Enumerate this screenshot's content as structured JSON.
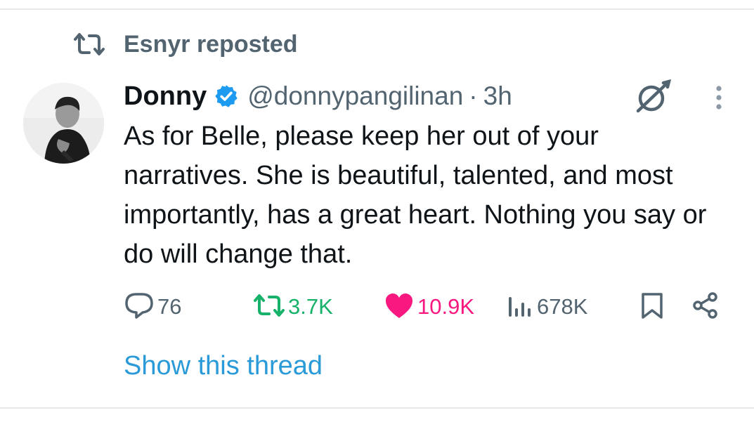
{
  "repost": {
    "label": "Esnyr reposted"
  },
  "tweet": {
    "display_name": "Donny",
    "handle": "@donnypangilinan",
    "separator": "·",
    "time": "3h",
    "text": "As for Belle, please keep her out of your narratives. She is beautiful, talented, and most importantly, has a great heart. Nothing you say or do will change that.",
    "verified": true
  },
  "actions": {
    "replies": "76",
    "reposts": "3.7K",
    "likes": "10.9K",
    "views": "678K",
    "liked": true,
    "reposted": true
  },
  "show_thread": "Show this thread",
  "colors": {
    "repost_green": "#17b26a",
    "like_pink": "#f91880",
    "link_blue": "#2a9ad8",
    "muted_gray": "#536471",
    "verified_blue": "#1d9bf0"
  },
  "icons": {
    "repost_header": "repost-icon",
    "verified": "verified-badge-icon",
    "grok": "grok-icon",
    "more": "more-vertical-icon",
    "reply": "reply-icon",
    "repost": "repost-icon",
    "like": "heart-icon",
    "views": "views-icon",
    "bookmark": "bookmark-icon",
    "share": "share-icon"
  }
}
